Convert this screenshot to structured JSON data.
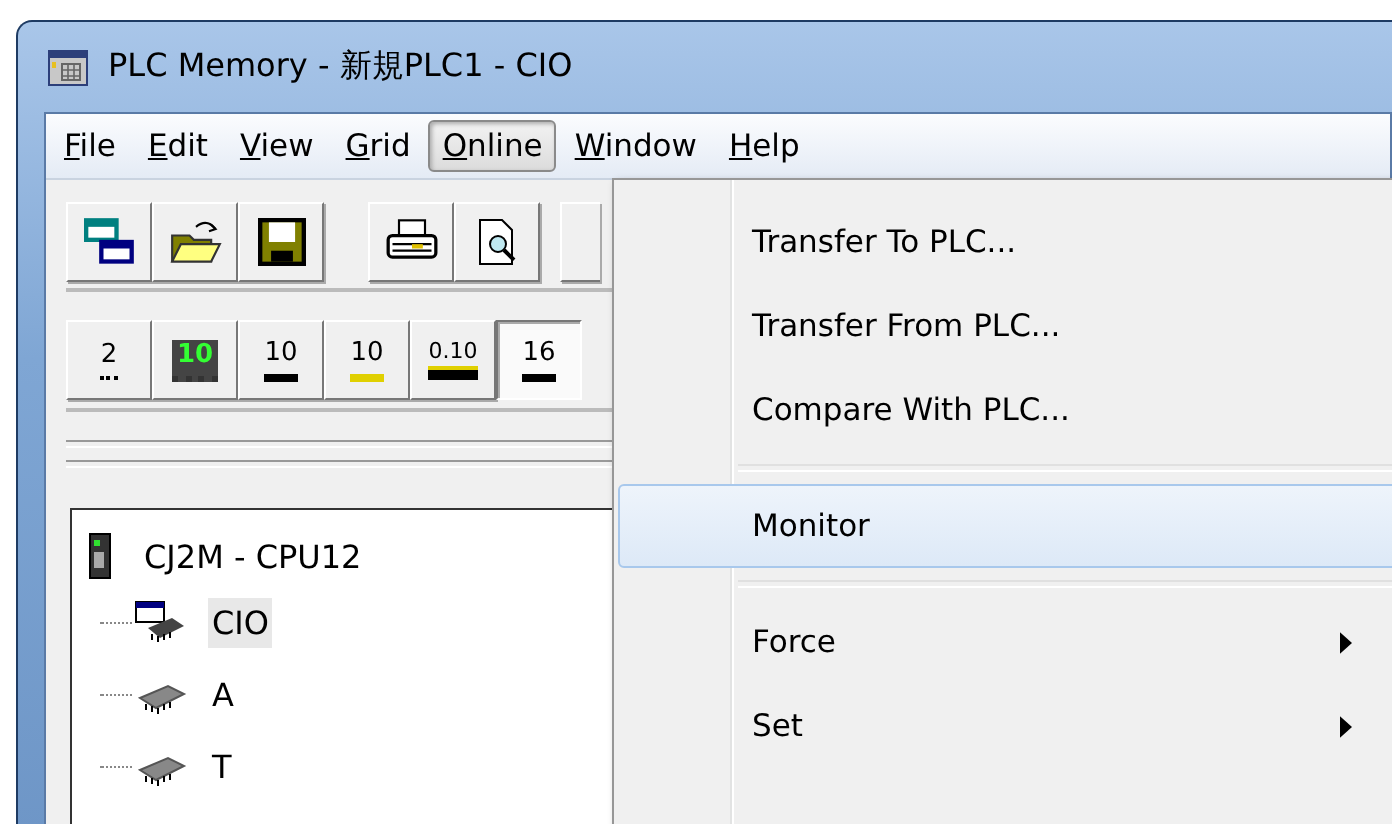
{
  "window": {
    "title": "PLC Memory - 新規PLC1 - CIO"
  },
  "menu_bar": [
    {
      "label": "File",
      "selected": false
    },
    {
      "label": "Edit",
      "selected": false
    },
    {
      "label": "View",
      "selected": false
    },
    {
      "label": "Grid",
      "selected": false
    },
    {
      "label": "Online",
      "selected": true
    },
    {
      "label": "Window",
      "selected": false
    },
    {
      "label": "Help",
      "selected": false
    }
  ],
  "toolbar_1": [
    {
      "kind": "windows"
    },
    {
      "kind": "open"
    },
    {
      "kind": "save"
    },
    {
      "kind": "gap"
    },
    {
      "kind": "print"
    },
    {
      "kind": "preview"
    }
  ],
  "toolbar_2": [
    {
      "kind": "binary",
      "label": "2",
      "pressed": false
    },
    {
      "kind": "bcd",
      "label": "10",
      "pressed": false
    },
    {
      "kind": "decimal",
      "label": "10",
      "pressed": false
    },
    {
      "kind": "signed",
      "label": "10",
      "pressed": false
    },
    {
      "kind": "float",
      "label": "0.10",
      "pressed": false
    },
    {
      "kind": "hex",
      "label": "16",
      "pressed": true
    }
  ],
  "tree": {
    "label": "CJ2M - CPU12",
    "children": [
      {
        "label": "CIO",
        "selected": true,
        "kind": "window-chip"
      },
      {
        "label": "A",
        "selected": false,
        "kind": "chip"
      },
      {
        "label": "T",
        "selected": false,
        "kind": "chip"
      }
    ]
  },
  "online_menu": [
    {
      "kind": "item",
      "label": "Transfer To PLC...",
      "highlighted": false,
      "submenu": false
    },
    {
      "kind": "item",
      "label": "Transfer From PLC...",
      "highlighted": false,
      "submenu": false
    },
    {
      "kind": "item",
      "label": "Compare With PLC...",
      "highlighted": false,
      "submenu": false
    },
    {
      "kind": "separator"
    },
    {
      "kind": "item",
      "label": "Monitor",
      "highlighted": true,
      "submenu": false
    },
    {
      "kind": "separator"
    },
    {
      "kind": "item",
      "label": "Force",
      "highlighted": false,
      "submenu": true
    },
    {
      "kind": "item",
      "label": "Set",
      "highlighted": false,
      "submenu": true
    }
  ]
}
